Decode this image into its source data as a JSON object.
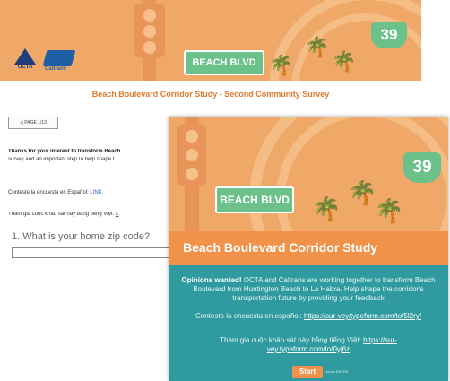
{
  "banner": {
    "street_sign": "BEACH BLVD",
    "route_number": "39",
    "logo_octa": "OCTA",
    "logo_caltrans": "Caltrans"
  },
  "survey": {
    "title": "Beach Boulevard Corridor Study - Second Community Survey",
    "back_button": "◁ PAGE 1/13",
    "thanks_bold": "Thanks for your interest to transform Beach",
    "thanks_rest": "survey and an important step to help shape t",
    "spanish_text": "Conteste la encuesta en Español:",
    "spanish_link": "LINK",
    "viet_text": "Tham gia cuộc khảo sát này bằng tiếng Việt:",
    "viet_link": "L",
    "question": "1. What is your home zip code?",
    "zip_value": ""
  },
  "card": {
    "street_sign": "BEACH BLVD",
    "route_number": "39",
    "study_title": "Beach Boulevard Corridor Study",
    "opinions_bold": "Opinions wanted!",
    "opinions_text": " OCTA and Caltrans are working together to transform Beach Boulevard from Huntington Beach to La Habra. Help shape the corridor's transportation future by providing your feedback",
    "es_text": "Conteste la encuesta en español: ",
    "es_link": "https://sur-vey.typeform.com/to/5l2ryf",
    "vi_text": "Tham gia cuộc khảo sát này bằng tiếng Việt: ",
    "vi_link": "https://sur-vey.typeform.com/to/0yj6z",
    "start_button": "Start",
    "start_hint": "press ENTER"
  },
  "colors": {
    "banner_orange": "#f0a868",
    "title_orange": "#e07a2e",
    "card_teal": "#2f9aa0",
    "sign_green": "#6cc08a",
    "study_bar": "#f0924a"
  }
}
